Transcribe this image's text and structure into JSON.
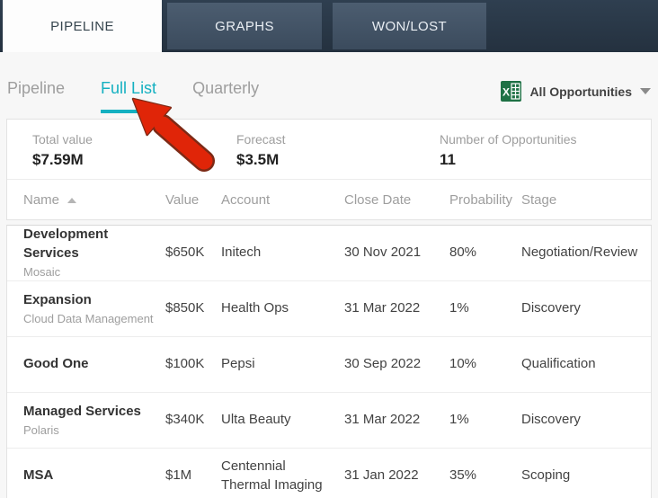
{
  "tabs": [
    {
      "label": "PIPELINE",
      "active": true
    },
    {
      "label": "GRAPHS",
      "active": false
    },
    {
      "label": "WON/LOST",
      "active": false
    }
  ],
  "subtabs": [
    {
      "label": "Pipeline",
      "active": false
    },
    {
      "label": "Full List",
      "active": true
    },
    {
      "label": "Quarterly",
      "active": false
    }
  ],
  "export": {
    "icon": "excel-icon",
    "label": "All Opportunities"
  },
  "summary": [
    {
      "label": "Total value",
      "value": "$7.59M"
    },
    {
      "label": "Forecast",
      "value": "$3.5M"
    },
    {
      "label": "Number of Opportunities",
      "value": "11"
    }
  ],
  "table": {
    "columns": [
      "Name",
      "Value",
      "Account",
      "Close Date",
      "Probability",
      "Stage"
    ],
    "sort": {
      "column": "Name",
      "direction": "asc"
    },
    "rows": [
      {
        "name": "Development Services",
        "subname": "Mosaic",
        "value": "$650K",
        "account": "Initech",
        "close_date": "30 Nov 2021",
        "probability": "80%",
        "stage": "Negotiation/Review"
      },
      {
        "name": "Expansion",
        "subname": "Cloud Data Management",
        "value": "$850K",
        "account": "Health Ops",
        "close_date": "31 Mar 2022",
        "probability": "1%",
        "stage": "Discovery"
      },
      {
        "name": "Good One",
        "subname": "",
        "value": "$100K",
        "account": "Pepsi",
        "close_date": "30 Sep 2022",
        "probability": "10%",
        "stage": "Qualification"
      },
      {
        "name": "Managed Services",
        "subname": "Polaris",
        "value": "$340K",
        "account": "Ulta Beauty",
        "close_date": "31 Mar 2022",
        "probability": "1%",
        "stage": "Discovery"
      },
      {
        "name": "MSA",
        "subname": "",
        "value": "$1M",
        "account": "Centennial Thermal Imaging",
        "close_date": "31 Jan 2022",
        "probability": "35%",
        "stage": "Scoping"
      }
    ]
  },
  "annotation": {
    "type": "arrow",
    "points_at": "Full List",
    "color": "#e02508",
    "outline": "#7d2a16"
  },
  "colors": {
    "accent_teal": "#14b0c1",
    "topbar": "#2c3b4a",
    "tab_inactive": "#46576a",
    "excel_green": "#1e7145"
  }
}
